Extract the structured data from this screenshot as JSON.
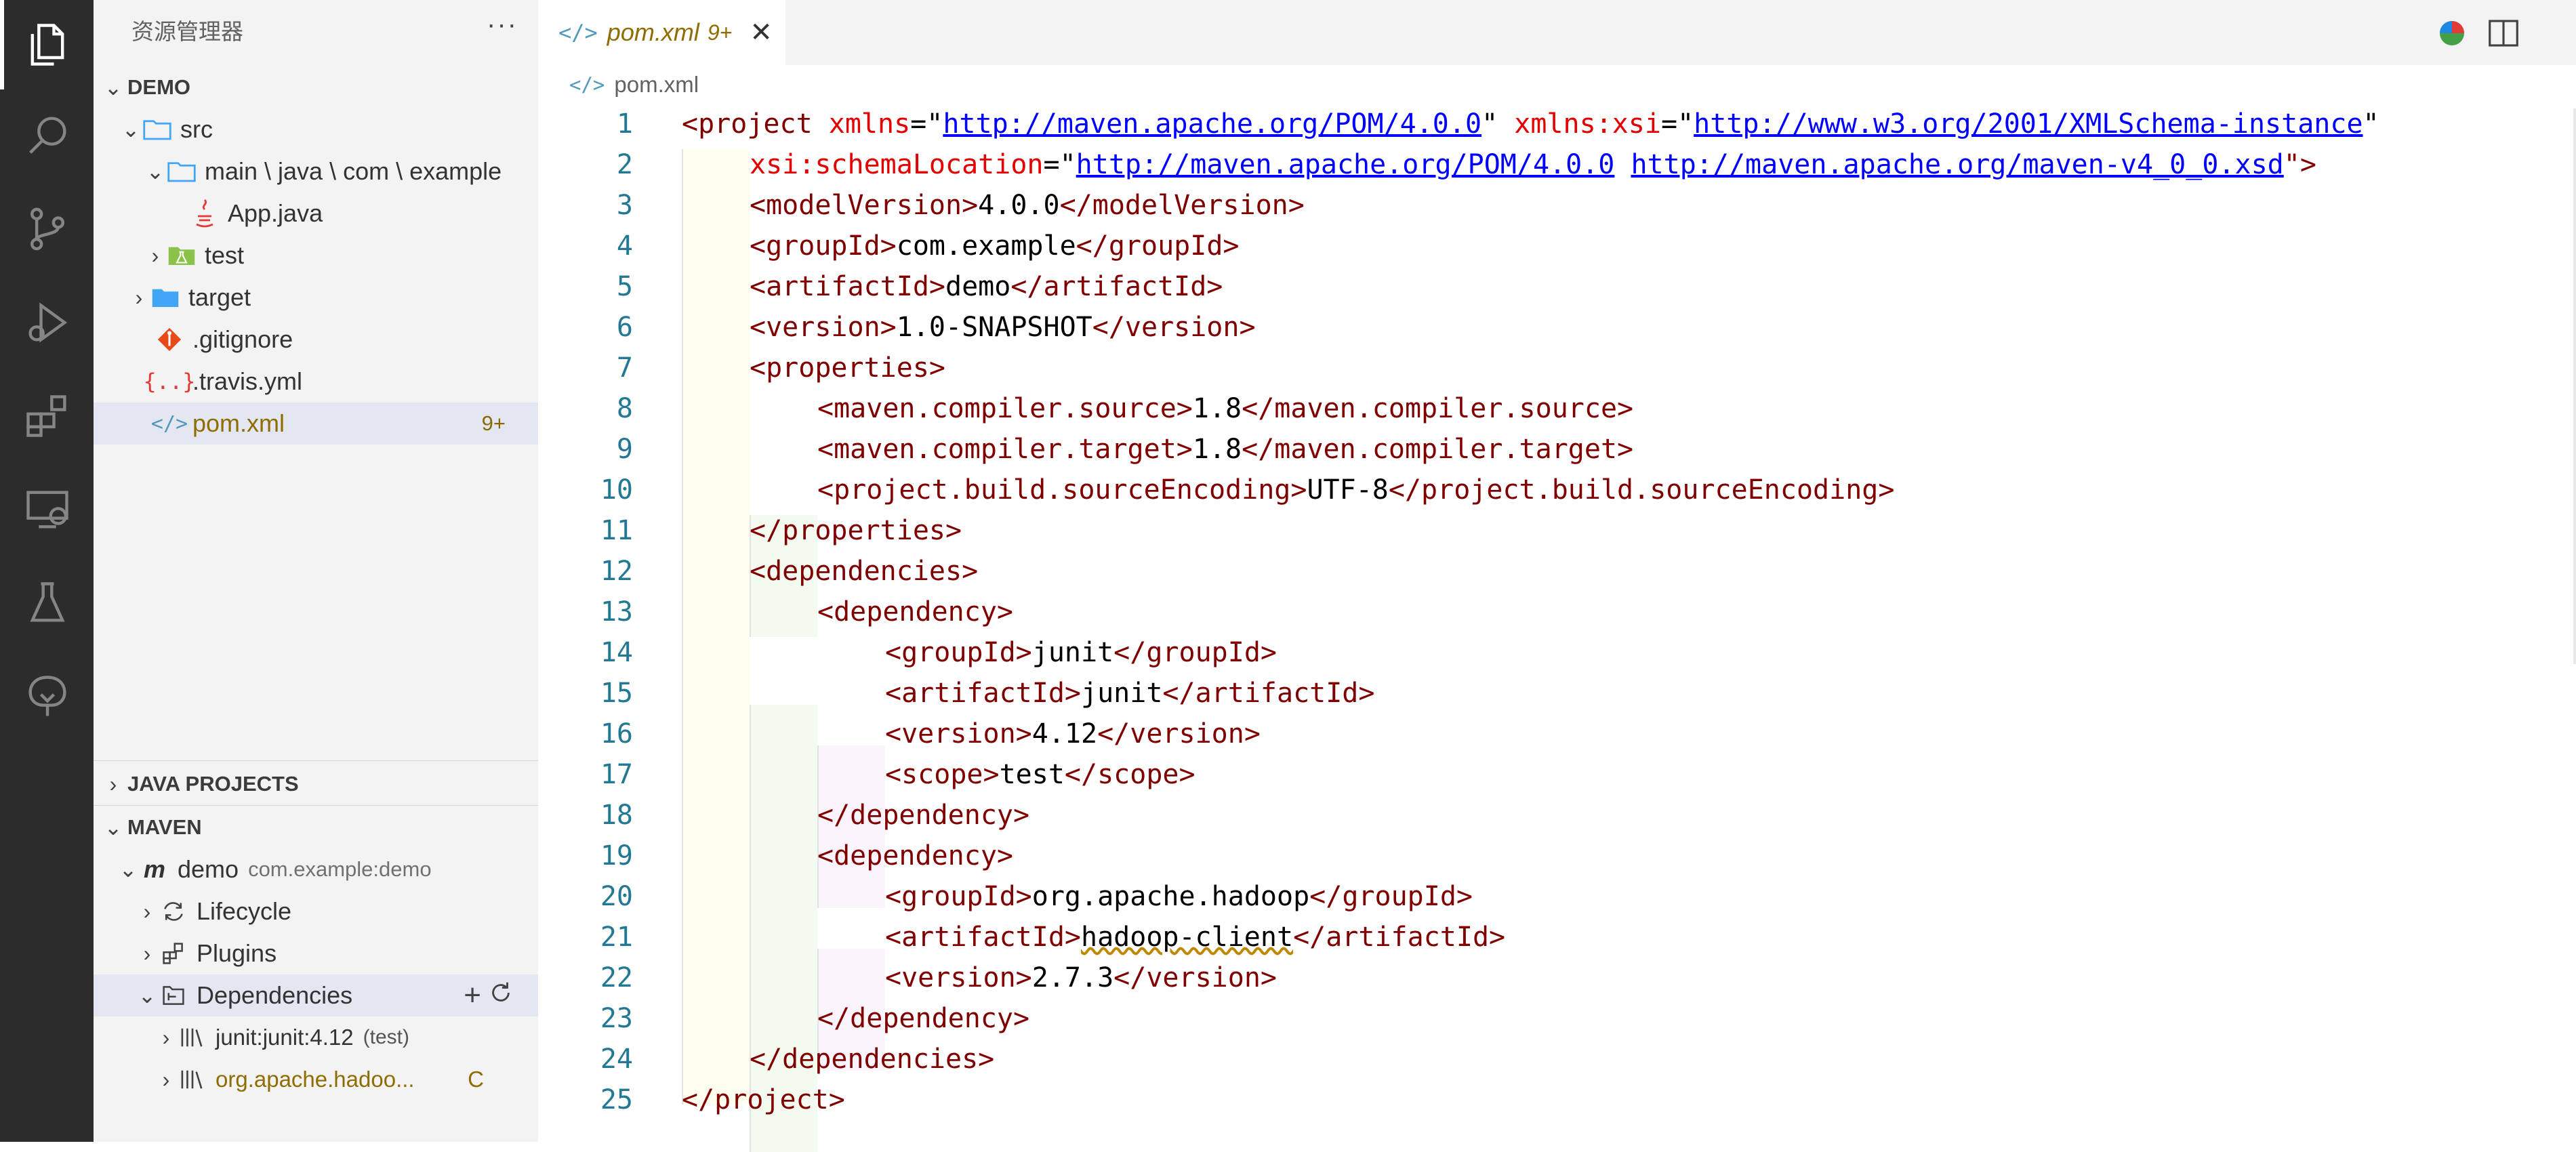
{
  "activity_bar": {
    "items": [
      "explorer-icon",
      "search-icon",
      "source-control-icon",
      "run-debug-icon",
      "extensions-icon",
      "remote-explorer-icon",
      "testing-icon",
      "spring-boot-icon"
    ]
  },
  "sidebar": {
    "title": "资源管理器",
    "more": "···",
    "explorer": {
      "header": "DEMO",
      "items": [
        {
          "label": "src"
        },
        {
          "label": "main \\ java \\ com \\ example"
        },
        {
          "label": "App.java"
        },
        {
          "label": "test"
        },
        {
          "label": "target"
        },
        {
          "label": ".gitignore"
        },
        {
          "label": ".travis.yml"
        },
        {
          "label": "pom.xml",
          "badge": "9+"
        }
      ]
    },
    "java_projects": {
      "header": "JAVA PROJECTS"
    },
    "maven": {
      "header": "MAVEN",
      "project": {
        "name": "demo",
        "id": "com.example:demo"
      },
      "items": [
        {
          "label": "Lifecycle"
        },
        {
          "label": "Plugins"
        },
        {
          "label": "Dependencies"
        }
      ],
      "deps": [
        {
          "label": "junit:junit:4.12",
          "scope": "(test)"
        },
        {
          "label": "org.apache.hadoo...",
          "badge": "C"
        }
      ]
    }
  },
  "tab": {
    "icon": "</>",
    "label": "pom.xml",
    "badge": "9+",
    "close": "✕"
  },
  "breadcrumb": {
    "icon": "</>",
    "label": "pom.xml"
  },
  "editor": {
    "line_numbers": [
      "1",
      "2",
      "3",
      "4",
      "5",
      "6",
      "7",
      "8",
      "9",
      "10",
      "11",
      "12",
      "13",
      "14",
      "15",
      "16",
      "17",
      "18",
      "19",
      "20",
      "21",
      "22",
      "23",
      "24",
      "25"
    ],
    "l1": {
      "open": "<project ",
      "attr1": "xmlns",
      "eq1": "=\"",
      "url1": "http://maven.apache.org/POM/4.0.0",
      "q1": "\" ",
      "attr2": "xmlns:xsi",
      "eq2": "=\"",
      "url2": "http://www.w3.org/2001/XMLSchema-instance",
      "q2": "\""
    },
    "l2": {
      "attr": "xsi:schemaLocation",
      "eq": "=\"",
      "url1": "http://maven.apache.org/POM/4.0.0",
      "sp": " ",
      "url2": "http://maven.apache.org/maven-v4_0_0.xsd",
      "end": "\">"
    },
    "l3": {
      "o": "<modelVersion>",
      "v": "4.0.0",
      "c": "</modelVersion>"
    },
    "l4": {
      "o": "<groupId>",
      "v": "com.example",
      "c": "</groupId>"
    },
    "l5": {
      "o": "<artifactId>",
      "v": "demo",
      "c": "</artifactId>"
    },
    "l6": {
      "o": "<version>",
      "v": "1.0-SNAPSHOT",
      "c": "</version>"
    },
    "l7": {
      "o": "<properties>"
    },
    "l8": {
      "o": "<maven.compiler.source>",
      "v": "1.8",
      "c": "</maven.compiler.source>"
    },
    "l9": {
      "o": "<maven.compiler.target>",
      "v": "1.8",
      "c": "</maven.compiler.target>"
    },
    "l10": {
      "o": "<project.build.sourceEncoding>",
      "v": "UTF-8",
      "c": "</project.build.sourceEncoding>"
    },
    "l11": {
      "c": "</properties>"
    },
    "l12": {
      "o": "<dependencies>"
    },
    "l13": {
      "o": "<dependency>"
    },
    "l14": {
      "o": "<groupId>",
      "v": "junit",
      "c": "</groupId>"
    },
    "l15": {
      "o": "<artifactId>",
      "v": "junit",
      "c": "</artifactId>"
    },
    "l16": {
      "o": "<version>",
      "v": "4.12",
      "c": "</version>"
    },
    "l17": {
      "o": "<scope>",
      "v": "test",
      "c": "</scope>"
    },
    "l18": {
      "c": "</dependency>"
    },
    "l19": {
      "o": "<dependency>"
    },
    "l20": {
      "o": "<groupId>",
      "v": "org.apache.hadoop",
      "c": "</groupId>"
    },
    "l21": {
      "o": "<artifactId>",
      "v": "hadoop-client",
      "c": "</artifactId>"
    },
    "l22": {
      "o": "<version>",
      "v": "2.7.3",
      "c": "</version>"
    },
    "l23": {
      "c": "</dependency>"
    },
    "l24": {
      "c": "</dependencies>"
    },
    "l25": {
      "c": "</project>"
    }
  }
}
